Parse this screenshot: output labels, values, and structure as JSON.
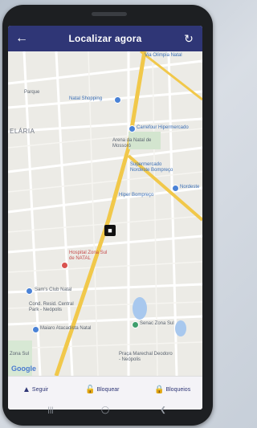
{
  "header": {
    "title": "Localizar agora",
    "back_icon": "arrow-left-icon",
    "refresh_icon": "refresh-icon"
  },
  "map": {
    "area_label": "ELÁRIA",
    "labels": {
      "parque": "Parque",
      "vila_olimpica": "Via Olímpia Natal",
      "natal_shopping": "Natal Shopping",
      "carrefour": "Carrefour Hipermercado",
      "arena": "Arena da Natal de Mossoró",
      "supermercado": "Supermercado Nordeste Bompreço",
      "nordeste": "Nordeste",
      "hiper_bompreco": "Hiper Bompreço",
      "hospital": "Hospital Zona Sul de NATAL",
      "sams": "Sam's Club Natal",
      "cond": "Cond. Resid. Central Park - Neópolis",
      "maiaro": "Maiaro Atacadista Natal",
      "senac": "Senac Zona Sul",
      "praca": "Praça Marechal Deodoro - Neópolis",
      "zona": "Zona Sul",
      "google": "Google"
    },
    "road_shields": [
      "101",
      "101"
    ]
  },
  "actions": {
    "follow": "Seguir",
    "block": "Bloquear",
    "blocked": "Bloqueios"
  },
  "colors": {
    "header_bg": "#2f3676",
    "accent": "#2f3676"
  }
}
